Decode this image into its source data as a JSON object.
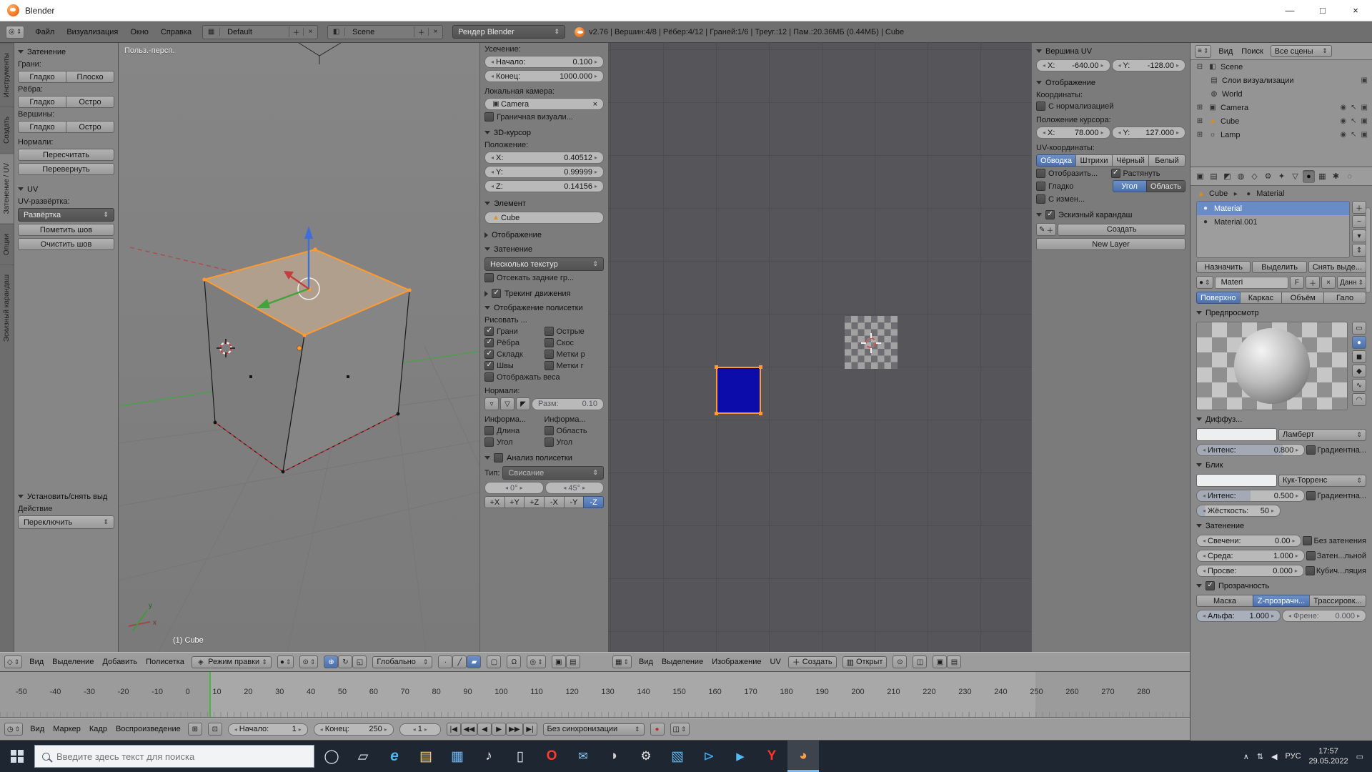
{
  "icons": {
    "dropdown": "⇕",
    "tri_small": "▾",
    "up": "▴",
    "plus": "＋",
    "minus": "−",
    "close": "×",
    "editor_info": "◎",
    "editor_3d": "◇",
    "editor_image": "▦",
    "editor_timeline": "◷",
    "outliner_menu": "≡",
    "layout": "▦",
    "scene": "◧",
    "mode_cube": "◈",
    "shade_sphere": "●",
    "pivot": "⊙",
    "manip_translate": "⊕",
    "manip_rotate": "↻",
    "manip_scale": "◱",
    "sel_vertex": "∙",
    "sel_edge": "╱",
    "sel_face": "▰",
    "occlude": "▢",
    "magnet": "Ω",
    "snap_target": "◎",
    "render_cam": "▣",
    "layers": "▤",
    "folder": "▥",
    "pin": "⊙",
    "scopes": "◫",
    "cam_small": "▣",
    "mesh": "▲",
    "world": "◍",
    "lamp": "☼",
    "eye": "◉",
    "select_arrow": "↖",
    "expander_open": "⊟",
    "expander_closed": "⊞",
    "normal_v": "▿",
    "normal_f": "▽",
    "normal_l": "◤",
    "pencil": "✎",
    "play": [
      "|◀",
      "◀◀",
      "◀",
      "▶",
      "▶▶",
      "▶|"
    ],
    "record": "●",
    "lock": "⊡",
    "range": "⊞",
    "props_strip": [
      "▣",
      "▤",
      "◩",
      "◍",
      "◇",
      "⚙",
      "✦",
      "▽",
      "●",
      "▦",
      "✱",
      "◌"
    ],
    "preview_types": [
      "▭",
      "●",
      "◼",
      "◆",
      "∿",
      "◠"
    ],
    "slot_sphere": "●",
    "crumb_sep": "▸"
  },
  "titlebar": {
    "title": "Blender",
    "minimize": "—",
    "maximize": "□",
    "close": "×"
  },
  "menubar": {
    "menus": [
      "Файл",
      "Визуализация",
      "Окно",
      "Справка"
    ],
    "layout_value": "Default",
    "scene_value": "Scene",
    "engine_value": "Рендер Blender",
    "stats": "v2.76 | Вершин:4/8 | Рёбер:4/12 | Граней:1/6 | Треуг.:12 | Пам.:20.36МБ (0.44МБ) | Cube"
  },
  "tool_tabs": [
    {
      "label": "Инструменты"
    },
    {
      "label": "Создать"
    },
    {
      "label": "Затенение / UV"
    },
    {
      "label": "Опции"
    },
    {
      "label": "Эскизный карандаш"
    }
  ],
  "tool_shelf": {
    "shading": {
      "title": "Затенение",
      "faces_label": "Грани:",
      "faces": [
        "Гладко",
        "Плоско"
      ],
      "edges_label": "Рёбра:",
      "edges": [
        "Гладко",
        "Остро"
      ],
      "verts_label": "Вершины:",
      "verts": [
        "Гладко",
        "Остро"
      ],
      "normals_label": "Нормали:",
      "normals": [
        "Пересчитать",
        "Перевернуть"
      ]
    },
    "uv": {
      "title": "UV",
      "unwrap_label": "UV-развёртка:",
      "unwrap_value": "Развёртка",
      "mark_seam": "Пометить шов",
      "clear_seam": "Очистить шов"
    },
    "set_deselect": {
      "title": "Установить/снять выд",
      "action_label": "Действие",
      "action_value": "Переключить"
    }
  },
  "viewport": {
    "view_name": "Польз.-персп.",
    "active_object": "(1) Cube",
    "gizmo_x": "x",
    "gizmo_y": "y"
  },
  "npanel3d": {
    "clip_label": "Усечение:",
    "clip_start_label": "Начало:",
    "clip_start_value": "0.100",
    "clip_end_label": "Конец:",
    "clip_end_value": "1000.000",
    "local_camera_label": "Локальная камера:",
    "camera_value": "Camera",
    "border_render": "Граничная визуали...",
    "cursor_title": "3D-курсор",
    "location_label": "Положение:",
    "cursor_x_label": "X:",
    "cursor_x": "0.40512",
    "cursor_y_label": "Y:",
    "cursor_y": "0.99999",
    "cursor_z_label": "Z:",
    "cursor_z": "0.14156",
    "item_title": "Элемент",
    "item_name": "Cube",
    "display_title": "Отображение",
    "shading_title": "Затенение",
    "shading_mode": "Несколько текстур",
    "backface": "Отсекать задние гр...",
    "tracking_title": "Трекинг движения",
    "meshdisplay_title": "Отображение полисетки",
    "draw_label": "Рисовать ...",
    "draw_left": [
      "Грани",
      "Рёбра",
      "Складк",
      "Швы"
    ],
    "draw_right": [
      "Острые",
      "Скос",
      "Метки р",
      "Метки г"
    ],
    "weights": "Отображать веса",
    "normals_label": "Нормали:",
    "normals_size_label": "Разм:",
    "normals_size": "0.10",
    "info_a": "Информа...",
    "info_b": "Информа...",
    "info_left": [
      "Длина",
      "Угол"
    ],
    "info_right": [
      "Область",
      "Угол"
    ],
    "analysis_title": "Анализ полисетки",
    "type_label": "Тип:",
    "type_value": "Свисание",
    "angle_min": "0°",
    "angle_max": "45°",
    "axes": [
      "+X",
      "+Y",
      "+Z",
      "-X",
      "-Y",
      "-Z"
    ]
  },
  "npanel_uv": {
    "vertex_title": "Вершина UV",
    "x_label": "X:",
    "x_value": "-640.00",
    "y_label": "Y:",
    "y_value": "-128.00",
    "display_title": "Отображение",
    "coords_label": "Координаты:",
    "normalized": "С нормализацией",
    "cursor_label": "Положение курсора:",
    "cx_label": "X:",
    "cx_value": "78.000",
    "cy_label": "Y:",
    "cy_value": "127.000",
    "uv_label": "UV-координаты:",
    "uv_modes": [
      "Обводка",
      "Штрихи",
      "Чёрный",
      "Белый"
    ],
    "display_modified": "Отобразить...",
    "stretch": "Растянуть",
    "smooth": "Гладко",
    "stretch_types": [
      "Угол",
      "Область"
    ],
    "modified_edges": "С измен...",
    "gp_title": "Эскизный карандаш",
    "gp_new": "Создать",
    "gp_new_layer": "New Layer"
  },
  "outliner": {
    "view_menu": "Вид",
    "search_menu": "Поиск",
    "display_mode": "Все сцены",
    "rows": [
      {
        "label": "Scene"
      },
      {
        "label": "Слои визуализации"
      },
      {
        "label": "World"
      },
      {
        "label": "Camera"
      },
      {
        "label": "Cube"
      },
      {
        "label": "Lamp"
      }
    ]
  },
  "properties": {
    "breadcrumb_object": "Cube",
    "breadcrumb_data": "Material",
    "slots": [
      {
        "name": "Material"
      },
      {
        "name": "Material.001"
      }
    ],
    "assign": "Назначить",
    "select": "Выделить",
    "deselect": "Снять выде...",
    "datablock_name": "Materi",
    "fake_user": "F",
    "users_label": "Данн",
    "type_tabs": [
      "Поверхно",
      "Каркас",
      "Объём",
      "Гало"
    ],
    "preview_title": "Предпросмотр",
    "diffuse_title": "Диффуз...",
    "diffuse_shader": "Ламберт",
    "diffuse_intensity_label": "Интенс:",
    "diffuse_intensity": "0.800",
    "diffuse_ramp": "Градиентна...",
    "specular_title": "Блик",
    "specular_shader": "Кук-Торренс",
    "specular_intensity_label": "Интенс:",
    "specular_intensity": "0.500",
    "specular_ramp": "Градиентна...",
    "hardness_label": "Жёсткость:",
    "hardness": "50",
    "shading_title": "Затенение",
    "emit_label": "Свечени:",
    "emit": "0.00",
    "shadeless": "Без затенения",
    "ambient_label": "Среда:",
    "ambient": "1.000",
    "shadow_only": "Затен...льной",
    "translucency_label": "Просве:",
    "translucency": "0.000",
    "cubic": "Кубич...ляция",
    "transparency_title": "Прозрачность",
    "transp_modes": [
      "Маска",
      "Z-прозрачн...",
      "Трассировк..."
    ],
    "alpha_label": "Альфа:",
    "alpha": "1.000",
    "fresnel_label": "Френе:",
    "fresnel": "0.000"
  },
  "header3d": {
    "menus": [
      "Вид",
      "Выделение",
      "Добавить",
      "Полисетка"
    ],
    "mode": "Режим правки",
    "orientation": "Глобально"
  },
  "header_uv": {
    "menus": [
      "Вид",
      "Выделение",
      "Изображение",
      "UV"
    ],
    "new_image": "Создать",
    "open_image": "Открыт"
  },
  "timeline": {
    "menus": [
      "Вид",
      "Маркер",
      "Кадр",
      "Воспроизведение"
    ],
    "start_label": "Начало:",
    "start": "1",
    "end_label": "Конец:",
    "end": "250",
    "current": "1",
    "sync": "Без синхронизации",
    "ruler": [
      "-50",
      "-40",
      "-30",
      "-20",
      "-10",
      "0",
      "10",
      "20",
      "30",
      "40",
      "50",
      "60",
      "70",
      "80",
      "90",
      "100",
      "110",
      "120",
      "130",
      "140",
      "150",
      "160",
      "170",
      "180",
      "190",
      "200",
      "210",
      "220",
      "230",
      "240",
      "250",
      "260",
      "270",
      "280"
    ]
  },
  "taskbar": {
    "search_placeholder": "Введите здесь текст для поиска",
    "apps": [
      {
        "name": "cortana",
        "glyph": "◯"
      },
      {
        "name": "task-view",
        "glyph": "▱"
      },
      {
        "name": "edge",
        "glyph": "e"
      },
      {
        "name": "file-explorer",
        "glyph": "▤"
      },
      {
        "name": "store",
        "glyph": "▦"
      },
      {
        "name": "media-player",
        "glyph": "♪"
      },
      {
        "name": "notepad",
        "glyph": "▯"
      },
      {
        "name": "opera",
        "glyph": "O"
      },
      {
        "name": "mail",
        "glyph": "✉"
      },
      {
        "name": "gimp",
        "glyph": "◗"
      },
      {
        "name": "settings",
        "glyph": "⚙"
      },
      {
        "name": "photos",
        "glyph": "▧"
      },
      {
        "name": "telegram",
        "glyph": "⊳"
      },
      {
        "name": "movies-tv",
        "glyph": "▶"
      },
      {
        "name": "yandex",
        "glyph": "Y"
      },
      {
        "name": "blender",
        "glyph": "◕"
      }
    ],
    "tray": {
      "expand": "∧",
      "net": "⇅",
      "vol": "◀",
      "lang": "РУС",
      "time": "17:57",
      "date": "29.05.2022",
      "notif": "▭"
    }
  }
}
